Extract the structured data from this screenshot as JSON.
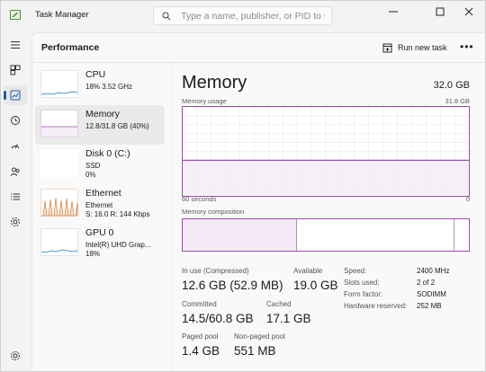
{
  "window": {
    "title": "Task Manager",
    "search_placeholder": "Type a name, publisher, or PID to s..."
  },
  "nav": {
    "icons": [
      "hamburger-menu-icon",
      "processes-icon",
      "performance-icon",
      "app-history-icon",
      "startup-apps-icon",
      "users-icon",
      "details-icon",
      "services-icon",
      "settings-icon"
    ],
    "active": "performance"
  },
  "header": {
    "title": "Performance",
    "run_new_task": "Run new task",
    "more": "•••"
  },
  "devices": [
    {
      "name": "CPU",
      "line1": "18%  3.52 GHz",
      "line2": ""
    },
    {
      "name": "Memory",
      "line1": "12.8/31.8 GB (40%)",
      "line2": ""
    },
    {
      "name": "Disk 0 (C:)",
      "line1": "SSD",
      "line2": "0%"
    },
    {
      "name": "Ethernet",
      "line1": "Ethernet",
      "line2": "S: 16.0  R: 144 Kbps"
    },
    {
      "name": "GPU 0",
      "line1": "Intel(R) UHD Grap...",
      "line2": "18%"
    }
  ],
  "memory": {
    "title": "Memory",
    "total": "32.0 GB",
    "usage_label": "Memory usage",
    "usage_max": "31.8 GB",
    "time_span": "60 seconds",
    "time_end": "0",
    "composition_label": "Memory composition",
    "usage_fraction": 0.4,
    "composition": {
      "in_use_fraction": 0.4,
      "standby_fraction": 0.55,
      "free_fraction": 0.05
    },
    "stats": {
      "in_use_label": "In use (Compressed)",
      "in_use_value": "12.6 GB (52.9 MB)",
      "available_label": "Available",
      "available_value": "19.0 GB",
      "committed_label": "Committed",
      "committed_value": "14.5/60.8 GB",
      "cached_label": "Cached",
      "cached_value": "17.1 GB",
      "paged_label": "Paged pool",
      "paged_value": "1.4 GB",
      "nonpaged_label": "Non-paged pool",
      "nonpaged_value": "551 MB"
    },
    "specs": [
      {
        "key": "Speed:",
        "value": "2400 MHz"
      },
      {
        "key": "Slots used:",
        "value": "2 of 2"
      },
      {
        "key": "Form factor:",
        "value": "SODIMM"
      },
      {
        "key": "Hardware reserved:",
        "value": "252 MB"
      }
    ]
  },
  "colors": {
    "memory_accent": "#9b4ea8",
    "cpu_accent": "#1b7ab8",
    "disk_accent": "#4c9e3a",
    "ethernet_accent": "#d2691e"
  }
}
